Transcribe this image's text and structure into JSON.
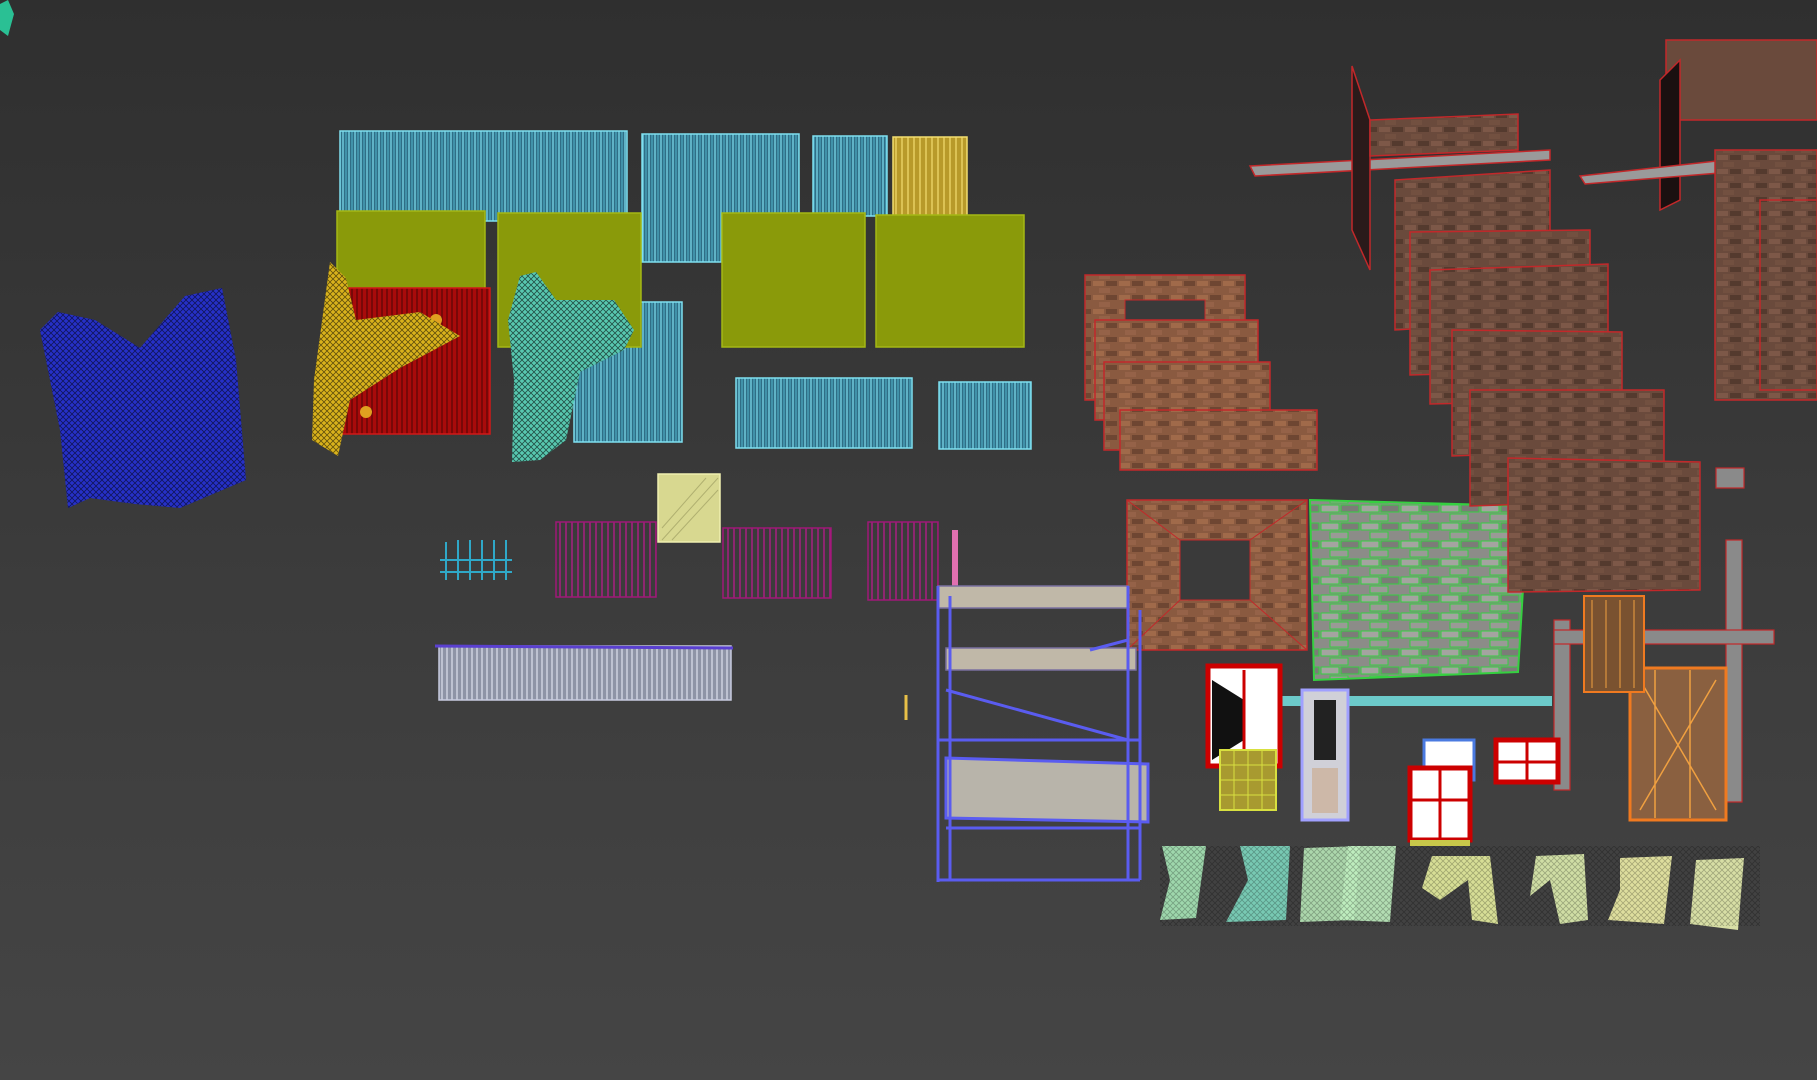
{
  "viewport": {
    "mode": "wireframe-perspective",
    "background_colors": [
      "#2f2f2f",
      "#454545"
    ],
    "wireframe_colors": {
      "blue": "#2630c8",
      "cyan": "#5cc8e0",
      "olive": "#8a9a0a",
      "yellow": "#d9b21c",
      "red": "#b00d0d",
      "teal": "#6fe0c8",
      "magenta": "#a01878",
      "brick_outline": "#c2282a",
      "scaffold": "#5a5cf0",
      "green_wall": "#28d040",
      "curtain": "#b8f0c0"
    }
  },
  "objects": [
    {
      "name": "cloth-blue"
    },
    {
      "name": "cloth-yellow"
    },
    {
      "name": "cloth-teal"
    },
    {
      "name": "wood-panels-cyan"
    },
    {
      "name": "panels-olive"
    },
    {
      "name": "panel-red"
    },
    {
      "name": "fences-magenta"
    },
    {
      "name": "balcony-rail-grey"
    },
    {
      "name": "brick-walls"
    },
    {
      "name": "scaffolding"
    },
    {
      "name": "windows"
    },
    {
      "name": "curtains"
    }
  ]
}
